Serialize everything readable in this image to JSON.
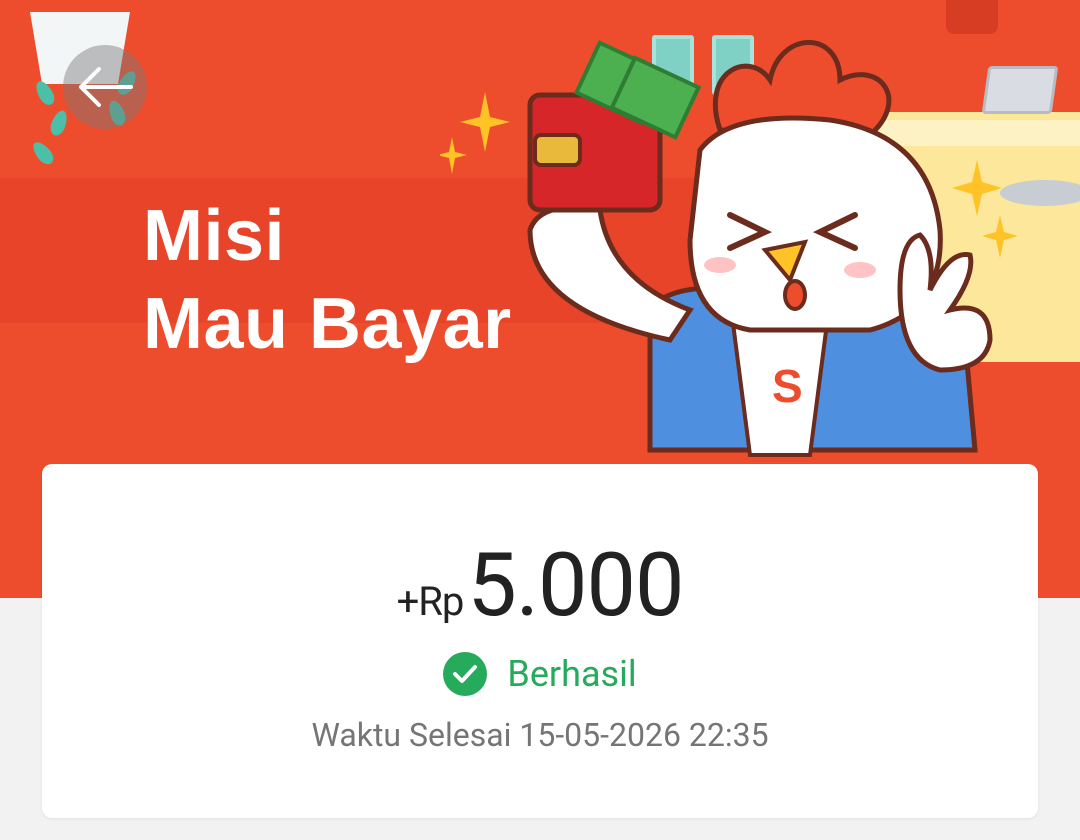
{
  "banner": {
    "title_line1": "Misi",
    "title_line2": "Mau Bayar",
    "background_color": "#ee4d2d",
    "back_icon": "arrow-left-icon",
    "mascot": "shopee-chicken-mascot-with-wallet"
  },
  "card": {
    "amount_prefix": "+Rp",
    "amount_value": "5.000",
    "status_icon": "check-circle-icon",
    "status_label": "Berhasil",
    "status_color": "#26aa5b",
    "completed_label": "Waktu Selesai",
    "completed_time": "15-05-2026 22:35"
  }
}
